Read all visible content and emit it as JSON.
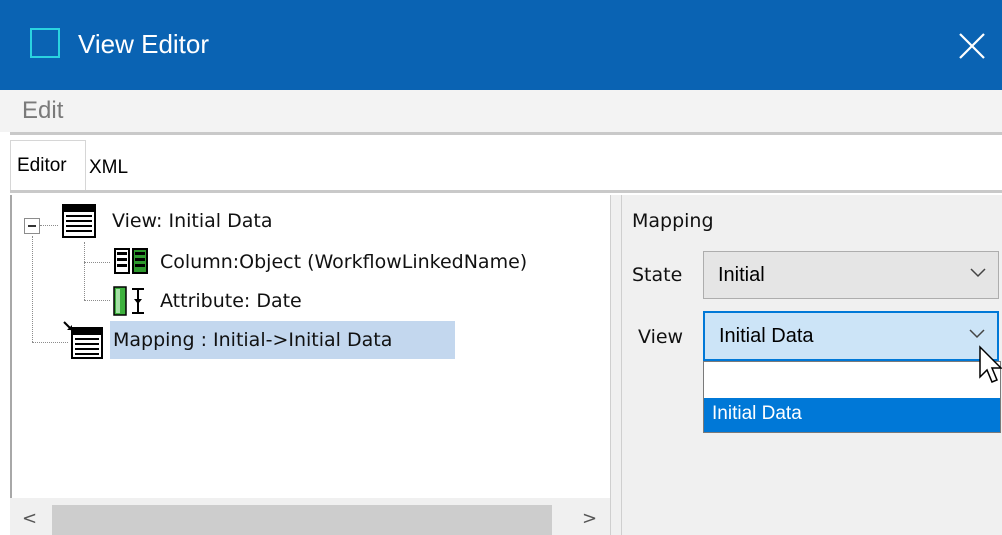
{
  "window": {
    "title": "View Editor",
    "title_bar_color": "#0a63b3",
    "icons": {
      "app": "window-icon",
      "close": "close-icon"
    }
  },
  "menu": {
    "items": [
      "Edit"
    ]
  },
  "tabs": [
    {
      "label": "Editor",
      "active": true
    },
    {
      "label": "XML",
      "active": false
    }
  ],
  "tree": {
    "root": {
      "label": "View: Initial Data",
      "expanded": true,
      "icon": "view-table-icon"
    },
    "children": [
      {
        "label": "Column:Object (WorkflowLinkedName)",
        "icon": "column-icon"
      },
      {
        "label": "Attribute: Date",
        "icon": "attribute-icon"
      }
    ],
    "mapping": {
      "label": "Mapping : Initial->Initial Data",
      "selected": true,
      "icon": "mapping-icon"
    }
  },
  "properties": {
    "group_label": "Mapping",
    "state": {
      "label": "State",
      "value": "Initial"
    },
    "view": {
      "label": "View",
      "value": "Initial Data",
      "focused": true
    },
    "dropdown": {
      "options": [
        "",
        "Initial Data"
      ],
      "selected": "Initial Data"
    }
  },
  "colors": {
    "accent": "#0078d7",
    "selection": "#c3d7ee"
  }
}
